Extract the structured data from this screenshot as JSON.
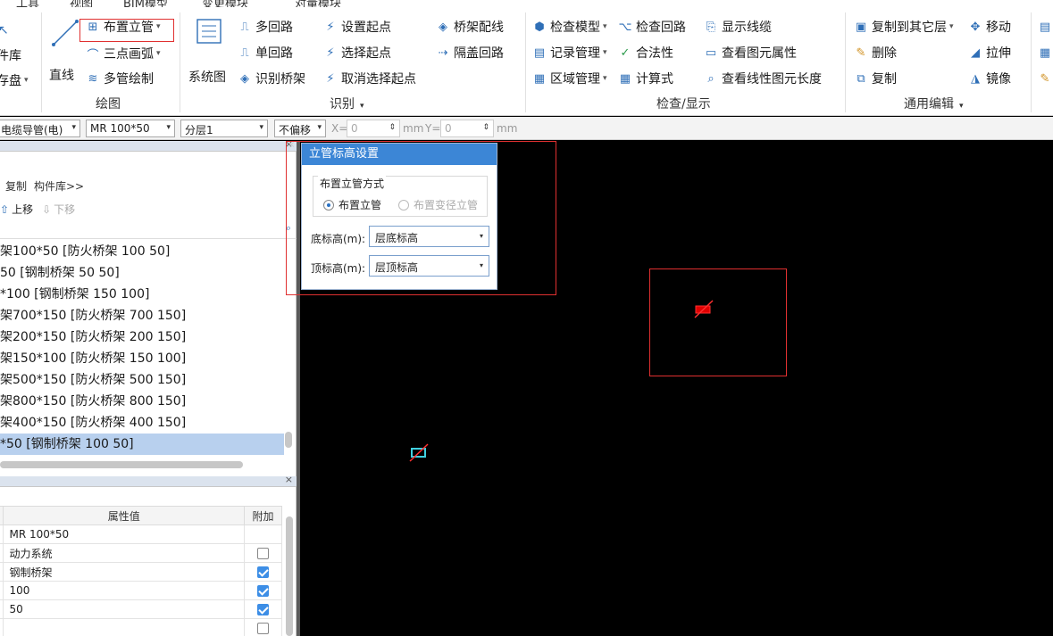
{
  "menu": {
    "items": [
      "工具",
      "视图",
      "BIM模型",
      "变更模块",
      "对量模块"
    ]
  },
  "ribbon": {
    "draw_group": {
      "label": "绘图",
      "line": "直线",
      "place_riser": "布置立管",
      "three_point_arc": "三点画弧",
      "multi_pipe": "多管绘制"
    },
    "left_partial": {
      "item1": "件库",
      "item2": "存盘"
    },
    "identify_group": {
      "label": "识别",
      "system_diagram": "系统图",
      "multi_circuit": "多回路",
      "single_circuit": "单回路",
      "identify_tray": "识别桥架",
      "set_start": "设置起点",
      "select_start": "选择起点",
      "cancel_select_start": "取消选择起点",
      "tray_wiring": "桥架配线",
      "cover_circuit": "隔盖回路"
    },
    "check_group": {
      "label": "检查/显示",
      "check_model": "检查模型",
      "record_mgmt": "记录管理",
      "area_mgmt": "区域管理",
      "check_circuit": "检查回路",
      "legality": "合法性",
      "calc_formula": "计算式",
      "show_cable": "显示线缆",
      "view_props": "查看图元属性",
      "view_length": "查看线性图元长度"
    },
    "edit_group": {
      "label": "通用编辑",
      "copy_to_layer": "复制到其它层",
      "delete": "删除",
      "copy": "复制",
      "move": "移动",
      "stretch": "拉伸",
      "mirror": "镜像"
    }
  },
  "toolbar": {
    "type_combo": "电缆导管(电)",
    "spec_combo": "MR 100*50",
    "layer_combo": "分层1",
    "offset_combo": "不偏移",
    "x_label": "X=",
    "x_value": "0",
    "y_label": "Y=",
    "y_value": "0",
    "unit_x": "mm",
    "unit_y": "mm"
  },
  "left_panel": {
    "copy": "复制",
    "library": "构件库>>",
    "move_up": "上移",
    "move_down": "下移",
    "items": [
      "架100*50 [防火桥架 100 50]",
      "50 [钢制桥架 50 50]",
      "*100 [钢制桥架 150 100]",
      "架700*150 [防火桥架 700 150]",
      "架200*150 [防火桥架 200 150]",
      "架150*100 [防火桥架 150 100]",
      "架500*150 [防火桥架 500 150]",
      "架800*150 [防火桥架 800 150]",
      "架400*150 [防火桥架 400 150]",
      "*50 [钢制桥架 100 50]"
    ]
  },
  "properties": {
    "col_value": "属性值",
    "col_extra": "附加",
    "rows": [
      {
        "value": "MR 100*50",
        "checked": null
      },
      {
        "value": "动力系统",
        "checked": false
      },
      {
        "value": "钢制桥架",
        "checked": true
      },
      {
        "value": "100",
        "checked": true
      },
      {
        "value": "50",
        "checked": true
      },
      {
        "value": "",
        "checked": false
      }
    ]
  },
  "dialog": {
    "title": "立管标高设置",
    "group_label": "布置立管方式",
    "opt1": "布置立管",
    "opt2": "布置变径立管",
    "bottom_label": "底标高(m):",
    "bottom_value": "层底标高",
    "top_label": "顶标高(m):",
    "top_value": "层顶标高"
  }
}
